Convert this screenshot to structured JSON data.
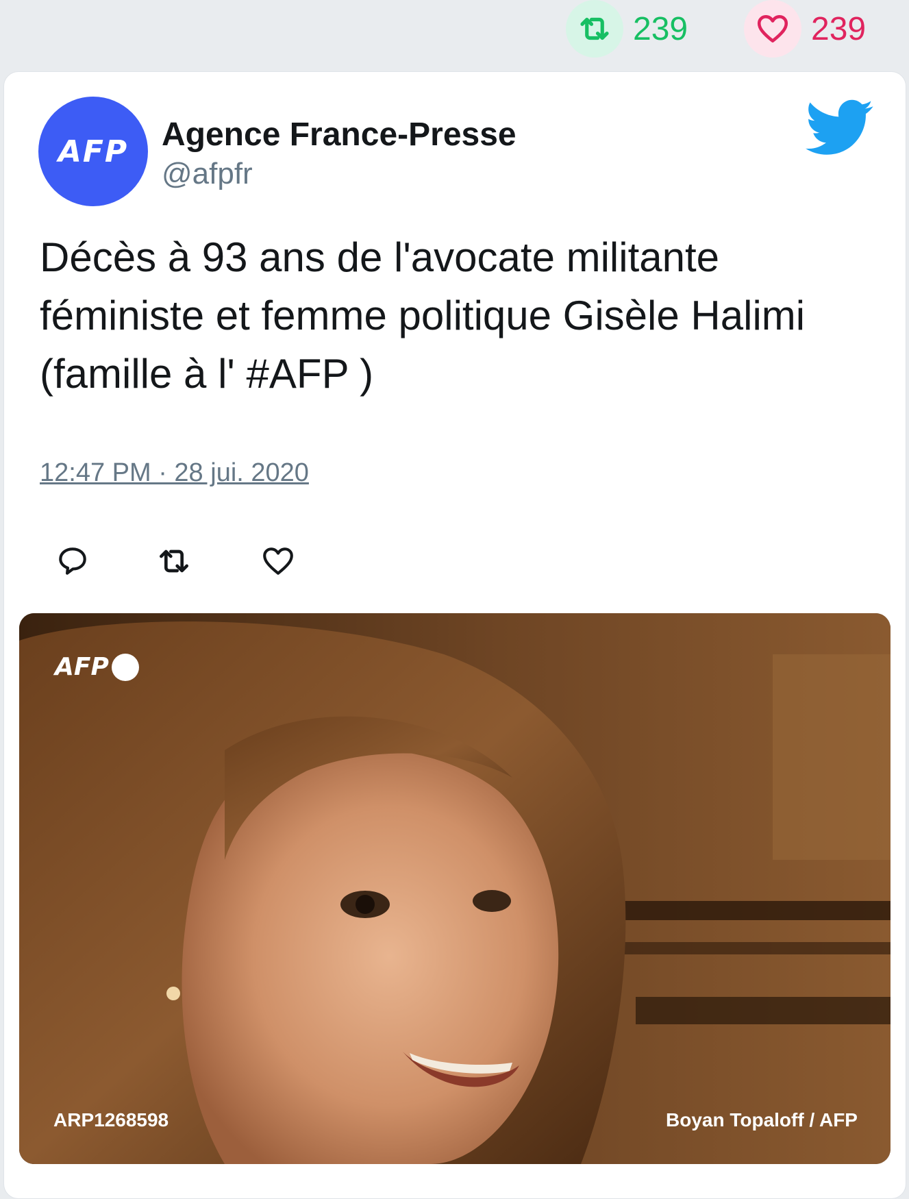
{
  "stats": {
    "retweet_count": "239",
    "like_count": "239"
  },
  "tweet": {
    "author": {
      "display_name": "Agence France-Presse",
      "handle": "@afpfr",
      "avatar_text": "AFP"
    },
    "text": "Décès à 93 ans de l'avocate militante féministe et femme politique Gisèle Halimi (famille à l' #AFP )",
    "timestamp": "12:47 PM · 28 jui. 2020",
    "media": {
      "logo_text": "AFP",
      "photo_id": "ARP1268598",
      "credit": "Boyan Topaloff / AFP"
    }
  },
  "colors": {
    "retweet": "#17bf63",
    "like": "#e0245e",
    "twitter_blue": "#1da1f2",
    "afp_blue": "#3d5cf5",
    "muted": "#657786"
  },
  "icons": {
    "retweet": "retweet-icon",
    "like": "heart-icon",
    "reply": "reply-icon",
    "brand": "twitter-bird-icon"
  }
}
